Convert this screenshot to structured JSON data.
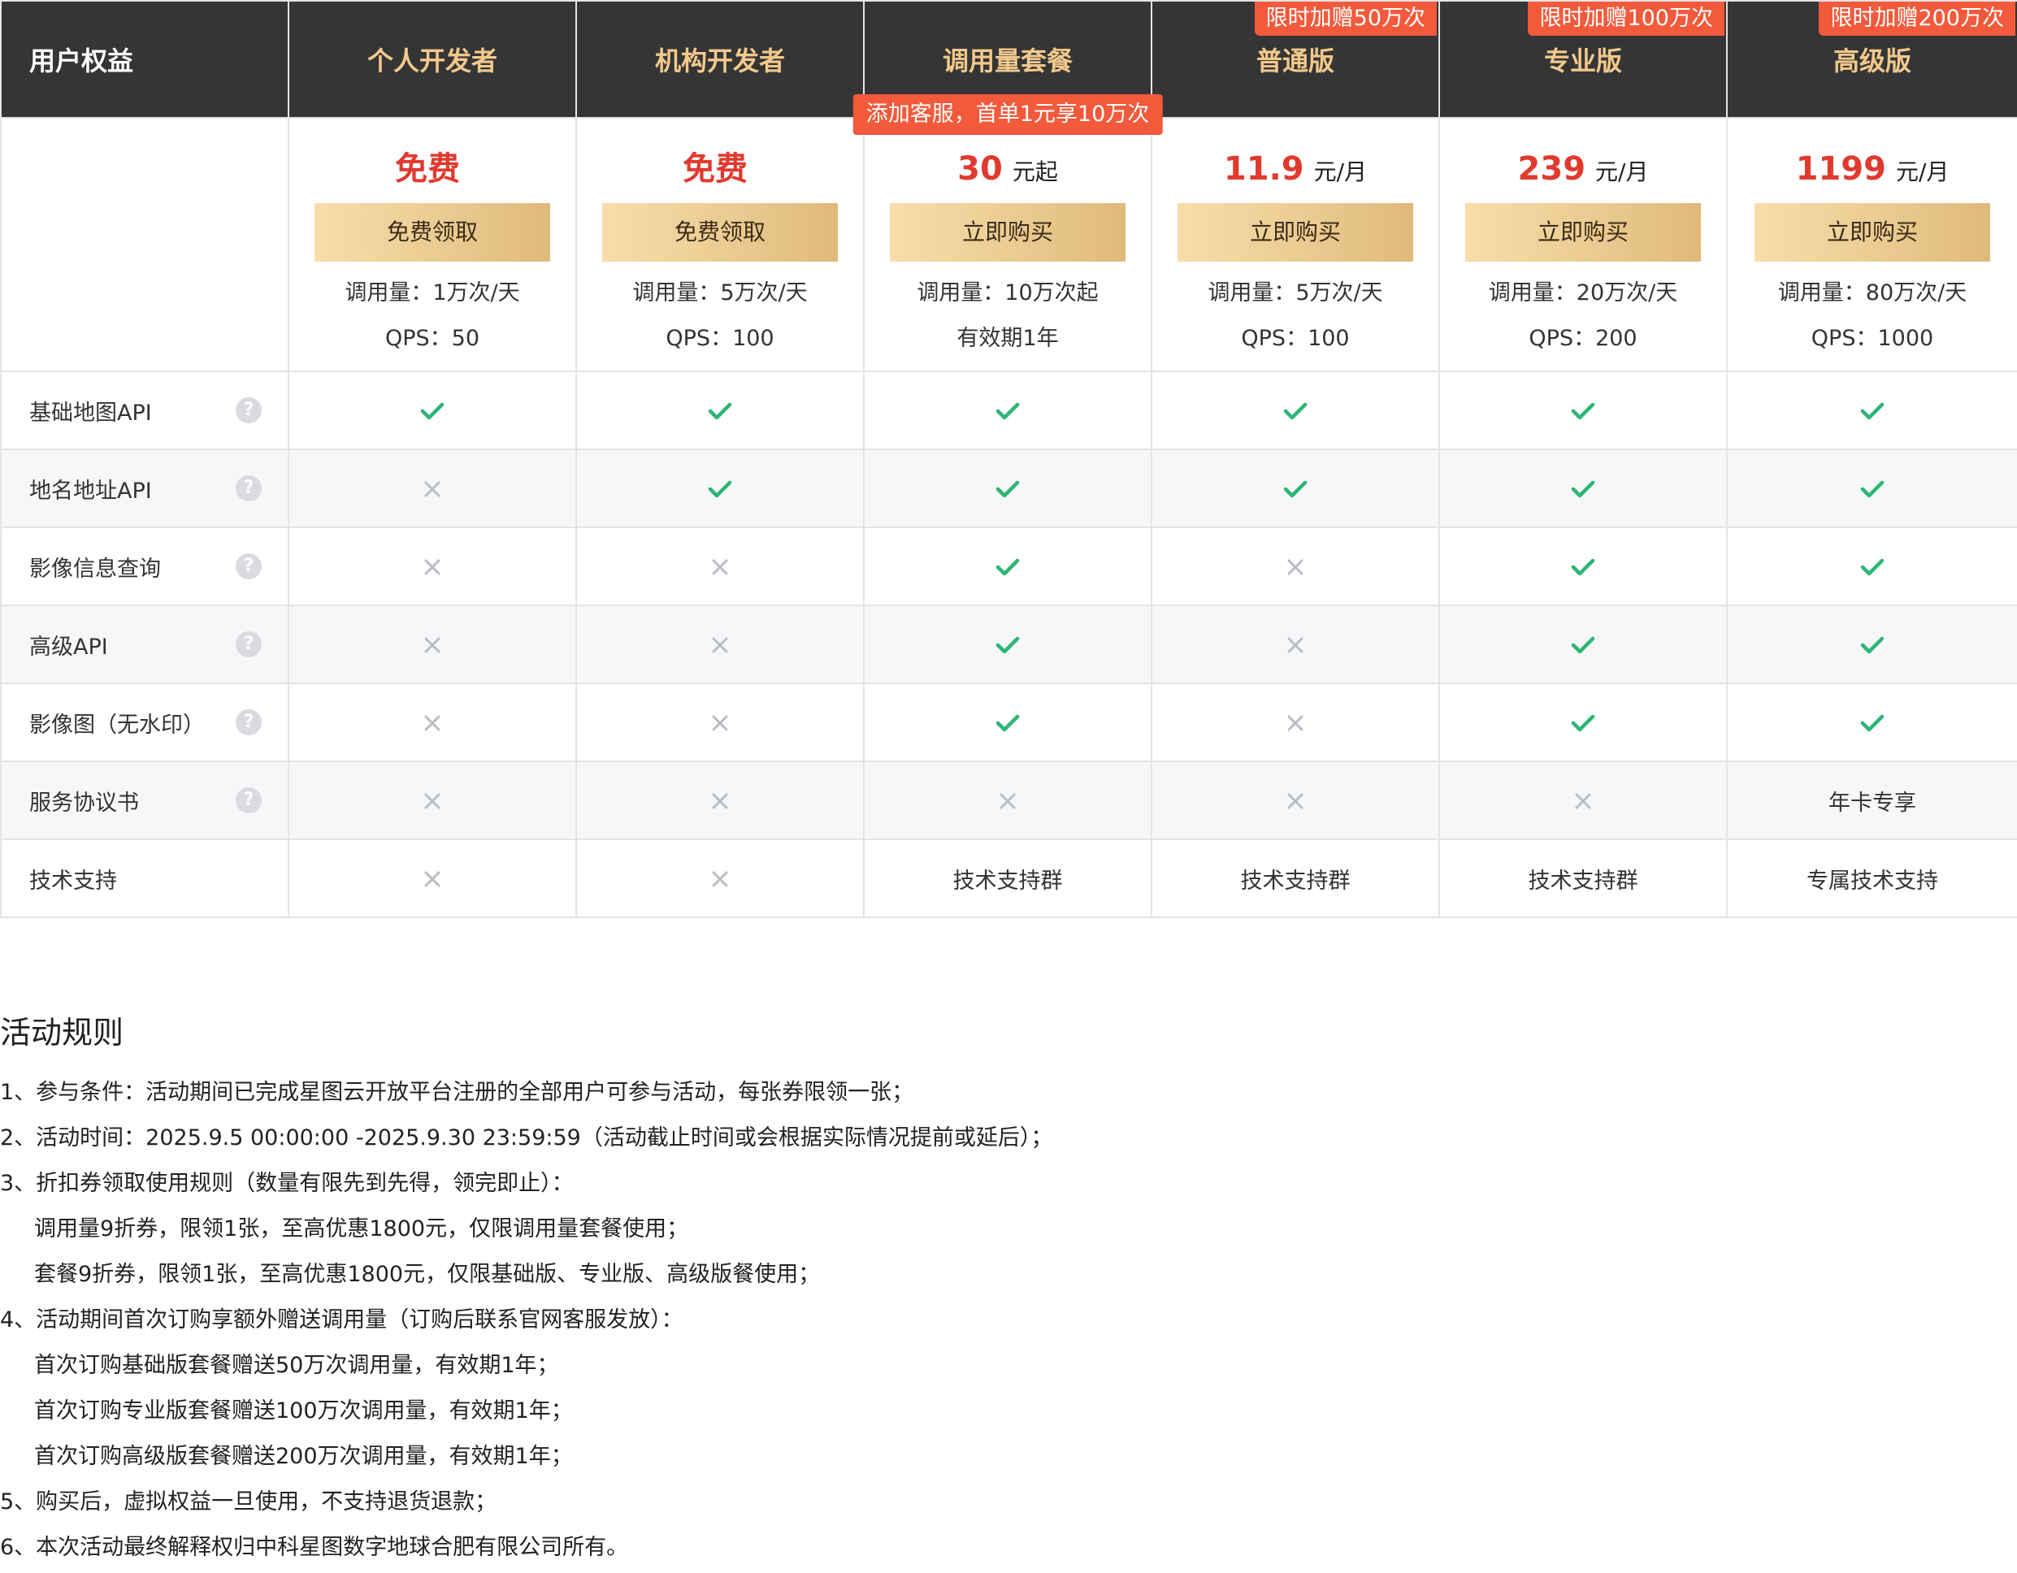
{
  "header": {
    "first_col": "用户权益",
    "plans": [
      {
        "name": "个人开发者",
        "promo": "",
        "service": ""
      },
      {
        "name": "机构开发者",
        "promo": "",
        "service": ""
      },
      {
        "name": "调用量套餐",
        "promo": "",
        "service": "添加客服，首单1元享10万次"
      },
      {
        "name": "普通版",
        "promo": "限时加赠50万次",
        "service": ""
      },
      {
        "name": "专业版",
        "promo": "限时加赠100万次",
        "service": ""
      },
      {
        "name": "高级版",
        "promo": "限时加赠200万次",
        "service": ""
      }
    ]
  },
  "pricing": [
    {
      "price": "免费",
      "unit": "",
      "button": "免费领取",
      "line1": "调用量：1万次/天",
      "line2": "QPS：50"
    },
    {
      "price": "免费",
      "unit": "",
      "button": "免费领取",
      "line1": "调用量：5万次/天",
      "line2": "QPS：100"
    },
    {
      "price": "30",
      "unit": "元起",
      "button": "立即购买",
      "line1": "调用量：10万次起",
      "line2": "有效期1年"
    },
    {
      "price": "11.9",
      "unit": "元/月",
      "button": "立即购买",
      "line1": "调用量：5万次/天",
      "line2": "QPS：100"
    },
    {
      "price": "239",
      "unit": "元/月",
      "button": "立即购买",
      "line1": "调用量：20万次/天",
      "line2": "QPS：200"
    },
    {
      "price": "1199",
      "unit": "元/月",
      "button": "立即购买",
      "line1": "调用量：80万次/天",
      "line2": "QPS：1000"
    }
  ],
  "features": [
    {
      "label": "基础地图API",
      "help": true,
      "cells": [
        "check",
        "check",
        "check",
        "check",
        "check",
        "check"
      ]
    },
    {
      "label": "地名地址API",
      "help": true,
      "cells": [
        "cross",
        "check",
        "check",
        "check",
        "check",
        "check"
      ]
    },
    {
      "label": "影像信息查询",
      "help": true,
      "cells": [
        "cross",
        "cross",
        "check",
        "cross",
        "check",
        "check"
      ]
    },
    {
      "label": "高级API",
      "help": true,
      "cells": [
        "cross",
        "cross",
        "check",
        "cross",
        "check",
        "check"
      ]
    },
    {
      "label": "影像图（无水印）",
      "help": true,
      "cells": [
        "cross",
        "cross",
        "check",
        "cross",
        "check",
        "check"
      ]
    },
    {
      "label": "服务协议书",
      "help": true,
      "cells": [
        "cross",
        "cross",
        "cross",
        "cross",
        "cross",
        "年卡专享"
      ]
    },
    {
      "label": "技术支持",
      "help": false,
      "cells": [
        "cross",
        "cross",
        "技术支持群",
        "技术支持群",
        "技术支持群",
        "专属技术支持"
      ]
    }
  ],
  "colors": {
    "check": "#2bb673",
    "cross": "#b8bcc4",
    "price": "#e03a2f",
    "badge": "#f25a3b",
    "header_bg": "#353535",
    "header_text": "#f2c98c"
  },
  "help_glyph": "?",
  "rules": {
    "title": "活动规则",
    "lines": [
      {
        "text": "1、参与条件：活动期间已完成星图云开放平台注册的全部用户可参与活动，每张券限领一张；",
        "indent": false
      },
      {
        "text": "2、活动时间：2025.9.5 00:00:00 -2025.9.30 23:59:59（活动截止时间或会根据实际情况提前或延后）；",
        "indent": false
      },
      {
        "text": "3、折扣券领取使用规则（数量有限先到先得，领完即止）：",
        "indent": false
      },
      {
        "text": "调用量9折券，限领1张，至高优惠1800元，仅限调用量套餐使用；",
        "indent": true
      },
      {
        "text": "套餐9折券，限领1张，至高优惠1800元，仅限基础版、专业版、高级版餐使用；",
        "indent": true
      },
      {
        "text": "4、活动期间首次订购享额外赠送调用量（订购后联系官网客服发放）：",
        "indent": false
      },
      {
        "text": "首次订购基础版套餐赠送50万次调用量，有效期1年；",
        "indent": true
      },
      {
        "text": "首次订购专业版套餐赠送100万次调用量，有效期1年；",
        "indent": true
      },
      {
        "text": "首次订购高级版套餐赠送200万次调用量，有效期1年；",
        "indent": true
      },
      {
        "text": "5、购买后，虚拟权益一旦使用，不支持退货退款；",
        "indent": false
      },
      {
        "text": "6、本次活动最终解释权归中科星图数字地球合肥有限公司所有。",
        "indent": false
      }
    ]
  }
}
